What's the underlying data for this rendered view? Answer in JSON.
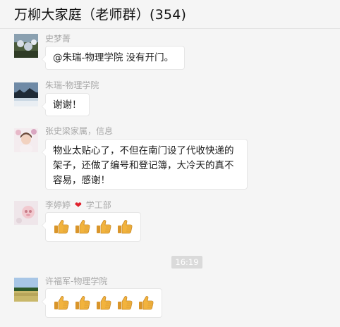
{
  "chat": {
    "title": "万柳大家庭（老师群）(354)"
  },
  "messages": [
    {
      "sender": "史梦菁",
      "text": "@朱瑞-物理学院 没有开门。"
    },
    {
      "sender": "朱瑞-物理学院",
      "text": "谢谢！"
    },
    {
      "sender": "张史梁家属，信息",
      "text": "物业太贴心了，不但在南门设了代收快递的架子，还做了编号和登记簿，大冷天的真不容易，感谢！"
    },
    {
      "sender": "李婷婷",
      "sender_suffix": "学工部",
      "emoji": "thumbs-up",
      "emoji_count": 4
    },
    {
      "sender": "许福军-物理学院",
      "emoji": "thumbs-up",
      "emoji_count": 5
    }
  ],
  "timestamp": "16:19",
  "colors": {
    "background": "#f5f5f5",
    "bubble": "#ffffff",
    "sender": "#a8a8a8",
    "time_badge": "#dadada",
    "heart": "#e0222d",
    "thumb": "#f2b33d"
  }
}
